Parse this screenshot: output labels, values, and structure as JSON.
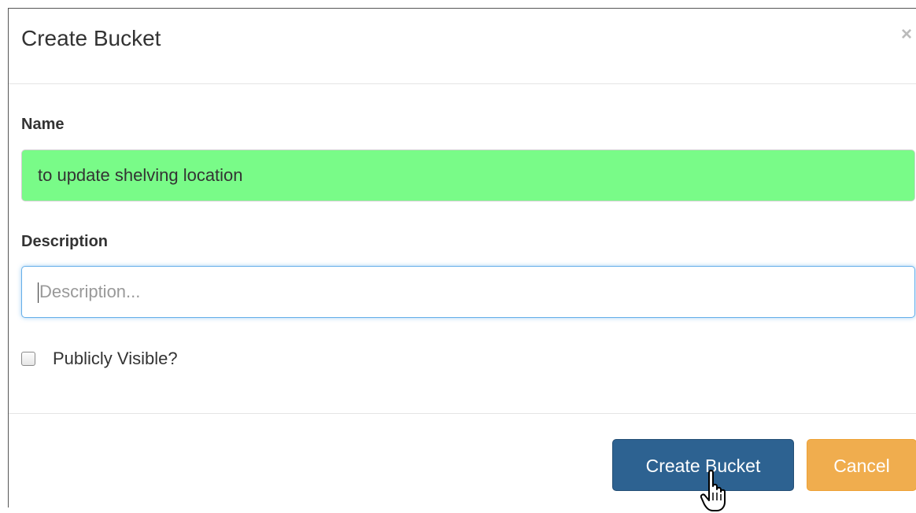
{
  "modal": {
    "title": "Create Bucket",
    "close_symbol": "×"
  },
  "form": {
    "name_label": "Name",
    "name_value": "to update shelving location",
    "description_label": "Description",
    "description_placeholder": "Description...",
    "public_label": "Publicly Visible?",
    "public_checked": false
  },
  "footer": {
    "create_label": "Create Bucket",
    "cancel_label": "Cancel"
  },
  "colors": {
    "name_field_bg": "#79fb88",
    "primary_button": "#2d6291",
    "cancel_button": "#f0ad4e",
    "focus_border": "#66afe9"
  },
  "icons": {
    "close": "close-icon",
    "cursor": "hand-pointer-icon"
  }
}
